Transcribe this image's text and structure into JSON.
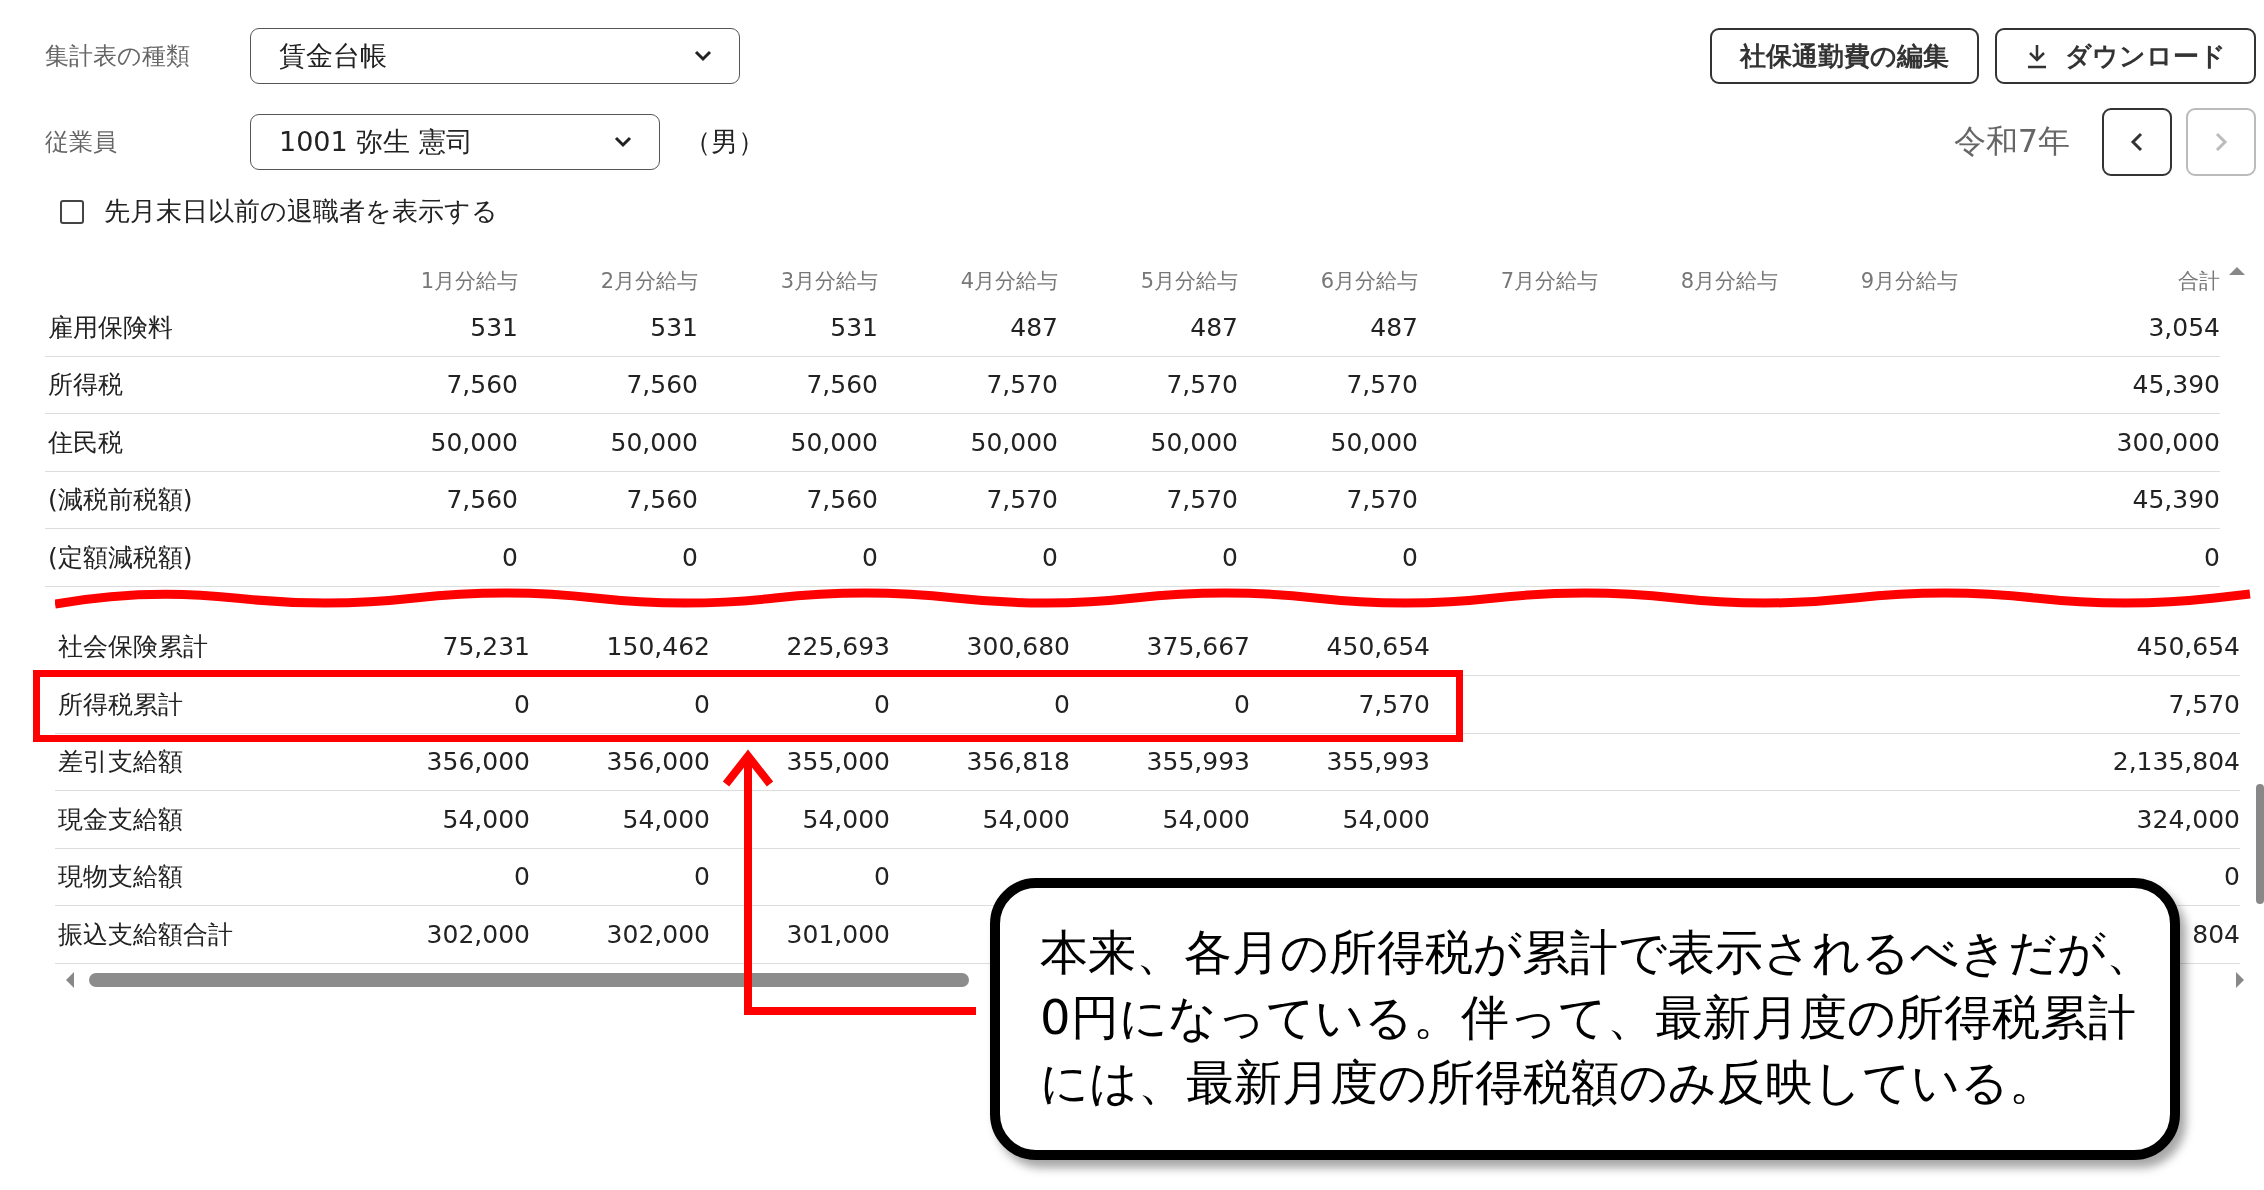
{
  "controls": {
    "report_type": {
      "label": "集計表の種類",
      "value": "賃金台帳"
    },
    "employee": {
      "label": "従業員",
      "value": "1001 弥生 憲司",
      "note": "（男）"
    },
    "show_retired": {
      "label": "先月末日以前の退職者を表示する",
      "checked": false
    }
  },
  "buttons": [
    {
      "kind": "plain",
      "label": "社保通勤費の編集"
    },
    {
      "kind": "download",
      "label": "ダウンロード"
    }
  ],
  "year": {
    "label": "令和7年",
    "prev_disabled": false,
    "next_disabled": true
  },
  "table_top": {
    "columns": [
      "1月分給与",
      "2月分給与",
      "3月分給与",
      "4月分給与",
      "5月分給与",
      "6月分給与",
      "7月分給与",
      "8月分給与",
      "9月分給与",
      "合計"
    ],
    "rows": [
      {
        "label": "雇用保険料",
        "cells": [
          "531",
          "531",
          "531",
          "487",
          "487",
          "487"
        ],
        "total": "3,054"
      },
      {
        "label": "所得税",
        "cells": [
          "7,560",
          "7,560",
          "7,560",
          "7,570",
          "7,570",
          "7,570"
        ],
        "total": "45,390"
      },
      {
        "label": "住民税",
        "cells": [
          "50,000",
          "50,000",
          "50,000",
          "50,000",
          "50,000",
          "50,000"
        ],
        "total": "300,000"
      },
      {
        "label": "(減税前税額)",
        "cells": [
          "7,560",
          "7,560",
          "7,560",
          "7,570",
          "7,570",
          "7,570"
        ],
        "total": "45,390"
      },
      {
        "label": "(定額減税額)",
        "cells": [
          "0",
          "0",
          "0",
          "0",
          "0",
          "0"
        ],
        "total": "0"
      }
    ]
  },
  "table_bottom": {
    "rows": [
      {
        "label": "社会保険累計",
        "cells": [
          "75,231",
          "150,462",
          "225,693",
          "300,680",
          "375,667",
          "450,654"
        ],
        "total": "450,654",
        "highlighted": false
      },
      {
        "label": "所得税累計",
        "cells": [
          "0",
          "0",
          "0",
          "0",
          "0",
          "7,570"
        ],
        "total": "7,570",
        "highlighted": true
      },
      {
        "label": "差引支給額",
        "cells": [
          "356,000",
          "356,000",
          "355,000",
          "356,818",
          "355,993",
          "355,993"
        ],
        "total": "2,135,804",
        "highlighted": false
      },
      {
        "label": "現金支給額",
        "cells": [
          "54,000",
          "54,000",
          "54,000",
          "54,000",
          "54,000",
          "54,000"
        ],
        "total": "324,000",
        "highlighted": false
      },
      {
        "label": "現物支給額",
        "cells": [
          "0",
          "0",
          "0",
          null,
          null,
          null
        ],
        "total": "0",
        "highlighted": false
      },
      {
        "label": "振込支給額合計",
        "cells": [
          "302,000",
          "302,000",
          "301,000",
          null,
          null,
          null
        ],
        "total": "804",
        "highlighted": false
      }
    ]
  },
  "callout": {
    "lines": [
      "本来、各月の所得税が累計で表示されるべきだが、",
      "0円になっている。伴って、最新月度の所得税累計",
      "には、最新月度の所得税額のみ反映している。"
    ]
  }
}
